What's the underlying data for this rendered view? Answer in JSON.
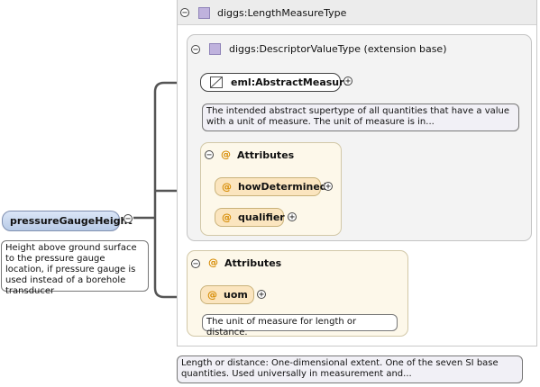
{
  "type": {
    "name": "diggs:LengthMeasureType",
    "base": {
      "name": "diggs:DescriptorValueType (extension base)",
      "element": {
        "name": "eml:AbstractMeasure",
        "doc": "The intended abstract supertype of all quantities that have a value with a unit of measure. The unit of measure is in..."
      },
      "attributes": {
        "title": "Attributes",
        "items": [
          "howDetermined",
          "qualifier"
        ]
      }
    },
    "attributes": {
      "title": "Attributes",
      "items": [
        {
          "name": "uom",
          "doc": "The unit of measure for length or distance."
        }
      ]
    },
    "doc": "Length or distance: One-dimensional extent. One of the seven SI base quantities. Used universally in measurement and..."
  },
  "root": {
    "name": "pressureGaugeHeight",
    "doc": "Height above ground surface to the pressure gauge location, if pressure gauge is used instead of a borehole transducer"
  },
  "symbols": {
    "attribute": "@",
    "collapse": "−",
    "expand": "+"
  }
}
